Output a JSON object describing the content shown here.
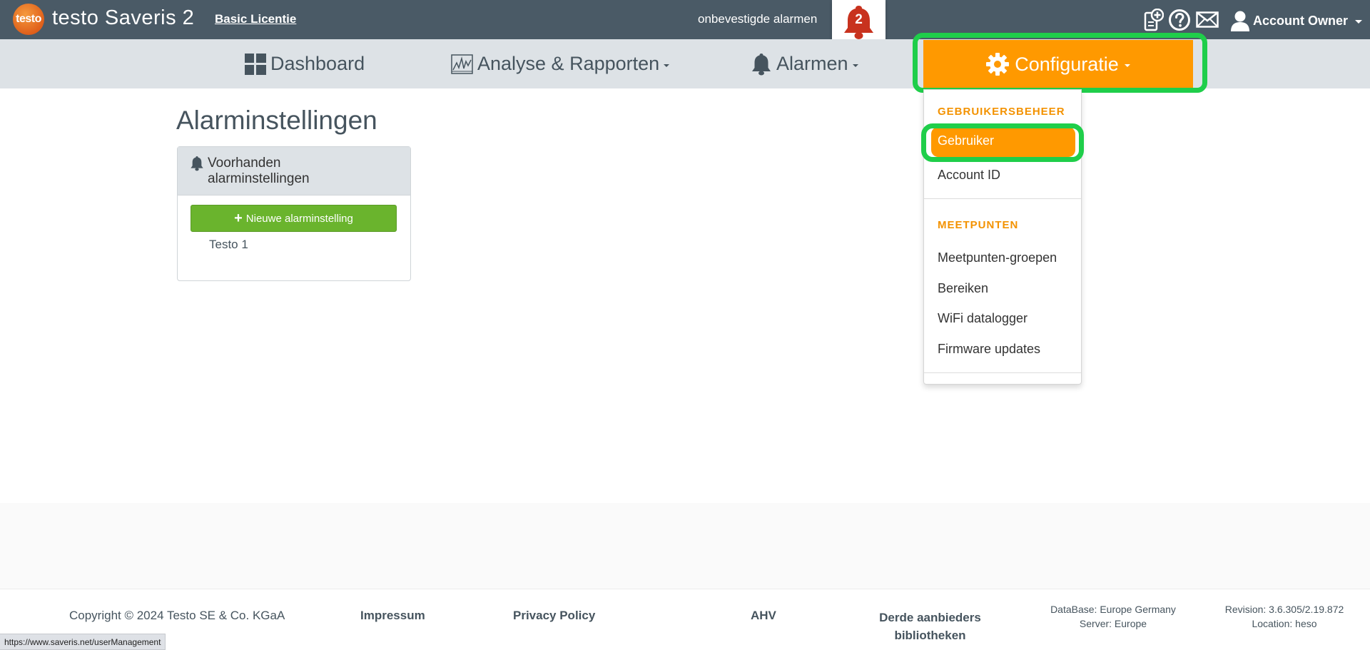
{
  "topbar": {
    "logo_text": "testo",
    "app_title": "testo Saveris 2",
    "license": "Basic Licentie",
    "unacknowledged_label": "onbevestigde alarmen",
    "alarm_count": "2",
    "icons": [
      "add-device-icon",
      "help-icon",
      "mail-icon",
      "user-icon"
    ],
    "account_name": "Account Owner"
  },
  "nav": {
    "dashboard": "Dashboard",
    "analysis": "Analyse & Rapporten",
    "alarms": "Alarmen",
    "configuration": "Configuratie"
  },
  "dropdown": {
    "user_mgmt_header": "GEBRUIKERSBEHEER",
    "user": "Gebruiker",
    "account_id": "Account ID",
    "measuring_points_header": "MEETPUNTEN",
    "groups": "Meetpunten-groepen",
    "ranges": "Bereiken",
    "wifi": "WiFi datalogger",
    "firmware": "Firmware updates"
  },
  "main": {
    "title": "Alarminstellingen",
    "panel_title": "Voorhanden alarminstellingen",
    "new_button": "Nieuwe alarminstelling",
    "items": [
      "Testo 1"
    ]
  },
  "footer": {
    "copyright": "Copyright © 2024 Testo SE & Co. KGaA",
    "impressum": "Impressum",
    "privacy": "Privacy Policy",
    "ahv": "AHV",
    "third_party_1": "Derde aanbieders",
    "third_party_2": "bibliotheken",
    "database": "DataBase: Europe Germany",
    "server": "Server: Europe",
    "revision": "Revision: 3.6.305/2.19.872",
    "location": "Location: heso"
  },
  "status_bar_url": "https://www.saveris.net/userManagement",
  "colors": {
    "topbar": "#4a5a66",
    "nav": "#dde2e6",
    "accent_orange": "#ff9900",
    "highlight_green": "#1fce4a",
    "button_green": "#6ab42d",
    "alarm_red": "#c8321e"
  }
}
